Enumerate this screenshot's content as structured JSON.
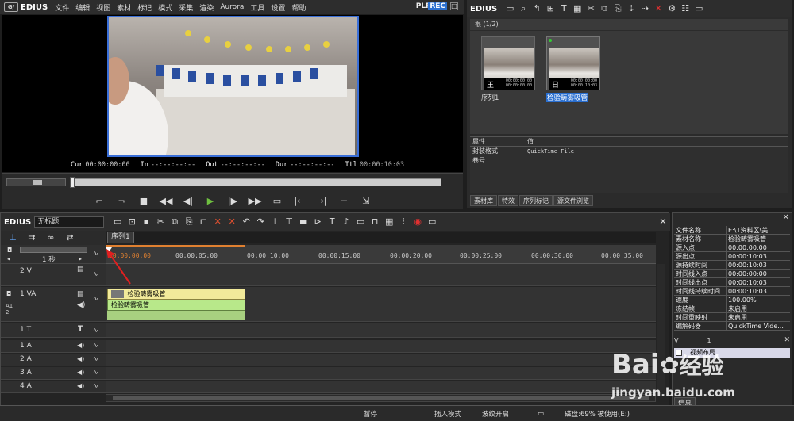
{
  "app": {
    "name": "EDIUS",
    "logo": "G/"
  },
  "menu": [
    "文件",
    "编辑",
    "视图",
    "素材",
    "标记",
    "模式",
    "采集",
    "渲染",
    "Aurora",
    "工具",
    "设置",
    "帮助"
  ],
  "mode": {
    "plr": "PLR",
    "rec": "REC"
  },
  "preview": {
    "cur_label": "Cur",
    "cur": "00:00:00:00",
    "in_label": "In",
    "in": "--:--:--:--",
    "out_label": "Out",
    "out": "--:--:--:--",
    "dur_label": "Dur",
    "dur": "--:--:--:--",
    "ttl_label": "Ttl",
    "ttl": "00:00:10:03"
  },
  "bin": {
    "title": "EDIUS",
    "folder": "根 (1/2)",
    "clips": [
      {
        "name": "序列1",
        "tc1": "00:00:00:00",
        "tc2": "00:00:00:00",
        "glyph": "王"
      },
      {
        "name": "检验畴雾吸管",
        "tc1": "00:00:00:00",
        "tc2": "00:00:10:03",
        "glyph": "日"
      }
    ],
    "props_header": {
      "k": "属性",
      "v": "值"
    },
    "props": [
      {
        "k": "封装格式",
        "v": "QuickTime File"
      },
      {
        "k": "卷号",
        "v": ""
      }
    ],
    "tabs": [
      "素材库",
      "特效",
      "序列标记",
      "源文件浏览"
    ]
  },
  "timeline": {
    "app": "EDIUS",
    "project": "无标题",
    "sequence_tab": "序列1",
    "zoom": "1 秒",
    "ruler": [
      "00:00:00:00",
      "00:00:05:00",
      "00:00:10:00",
      "00:00:15:00",
      "00:00:20:00",
      "00:00:25:00",
      "00:00:30:00",
      "00:00:35:00"
    ],
    "tracks": [
      {
        "label": "2 V"
      },
      {
        "label": "1 VA"
      },
      {
        "label": "1 T"
      },
      {
        "label": "1 A"
      },
      {
        "label": "2 A"
      },
      {
        "label": "3 A"
      },
      {
        "label": "4 A"
      }
    ],
    "track_side": "A1 2",
    "clip_video": "检验畴雾吸管",
    "clip_audio": "检验畴雾吸管"
  },
  "info": {
    "rows": [
      {
        "k": "文件名称",
        "v": "E:\\1资料区\\美..."
      },
      {
        "k": "素材名称",
        "v": "检验畴雾吸管"
      },
      {
        "k": "源入点",
        "v": "00:00:00:00"
      },
      {
        "k": "源出点",
        "v": "00:00:10:03"
      },
      {
        "k": "源持续时间",
        "v": "00:00:10:03"
      },
      {
        "k": "时间线入点",
        "v": "00:00:00:00"
      },
      {
        "k": "时间线出点",
        "v": "00:00:10:03"
      },
      {
        "k": "时间线持续时间",
        "v": "00:00:10:03"
      },
      {
        "k": "速度",
        "v": "100.00%"
      },
      {
        "k": "冻结帧",
        "v": "未启用"
      },
      {
        "k": "时间重映射",
        "v": "未启用"
      },
      {
        "k": "编解码器",
        "v": "QuickTime Vide..."
      }
    ],
    "track_num": "1",
    "effect_v": "V",
    "effect_label": "视频布局",
    "tab": "信息"
  },
  "status": {
    "state": "暂停",
    "insert": "插入模式",
    "ripple": "波纹开启",
    "disk": "磁盘:69% 被使用(E:)"
  },
  "watermark": {
    "brand": "Bai",
    "brand2": "经验",
    "url": "jingyan.baidu.com"
  }
}
